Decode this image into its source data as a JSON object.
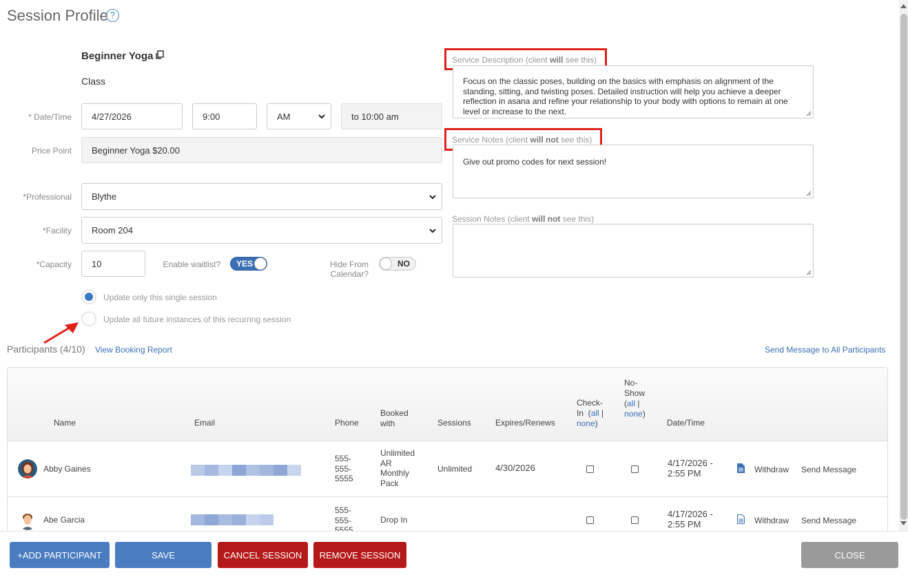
{
  "header": {
    "title": "Session Profile",
    "help_glyph": "?"
  },
  "service": {
    "name": "Beginner Yoga",
    "type": "Class"
  },
  "form": {
    "datetime_label": "* Date/Time",
    "date": "4/27/2026",
    "time": "9:00",
    "ampm": "AM",
    "end_time": "to 10:00 am",
    "price_label": "Price Point",
    "price": "Beginner Yoga $20.00",
    "professional_label": "*Professional",
    "professional": "Blythe",
    "facility_label": "*Facility",
    "facility": "Room 204",
    "capacity_label": "*Capacity",
    "capacity": "10",
    "waitlist_label": "Enable waitlist?",
    "waitlist_value": "YES",
    "hide_label": "Hide From Calendar?",
    "hide_value": "NO",
    "radio_single": "Update only this single session",
    "radio_future": "Update all future instances of this recurring session"
  },
  "notes": {
    "desc_label_pre": "Service Description (client ",
    "desc_label_bold": "will",
    "desc_label_post": " see this)",
    "desc_text": "Focus on the classic poses, building on the basics with emphasis on alignment of the standing, sitting, and twisting poses. Detailed instruction will help you achieve a deeper reflection in asana and refine your relationship to your body with options to remain at one level or increase to the next.",
    "svc_notes_label_pre": "Service Notes (client ",
    "svc_notes_label_bold": "will not",
    "svc_notes_label_post": " see this)",
    "svc_notes_text": "Give out promo codes for next session!",
    "session_notes_label_pre": "Session Notes (client ",
    "session_notes_label_bold": "will not",
    "session_notes_label_post": " see this)",
    "session_notes_text": ""
  },
  "participants": {
    "title": "Participants (4/10)",
    "view_report": "View Booking Report",
    "send_all": "Send Message to All Participants",
    "headers": {
      "name": "Name",
      "email": "Email",
      "phone": "Phone",
      "booked": "Booked with",
      "sessions": "Sessions",
      "expires": "Expires/Renews",
      "checkin": "Check-In",
      "noshow": "No-Show",
      "all": "all",
      "sep": "|",
      "none": "none",
      "datetime": "Date/Time"
    },
    "rows": [
      {
        "name": "Abby Gaines",
        "phone": "555-555-5555",
        "booked": "Unlimited AR Monthly Pack",
        "sessions": "Unlimited",
        "expires": "4/30/2026",
        "datetime": "4/17/2026 - 2:55 PM",
        "withdraw": "Withdraw",
        "send": "Send Message"
      },
      {
        "name": "Abe Garcia",
        "phone": "555-555-5555",
        "booked": "Drop In",
        "sessions": "",
        "expires": "",
        "datetime": "4/17/2026 - 2:55 PM",
        "withdraw": "Withdraw",
        "send": "Send Message"
      }
    ]
  },
  "footer": {
    "add": "+ADD PARTICIPANT",
    "save": "SAVE",
    "cancel": "CANCEL SESSION",
    "remove": "REMOVE SESSION",
    "close": "CLOSE"
  },
  "colors": {
    "accent": "#3b6fb3",
    "danger": "#b51a1a",
    "highlight": "#e0211b"
  }
}
